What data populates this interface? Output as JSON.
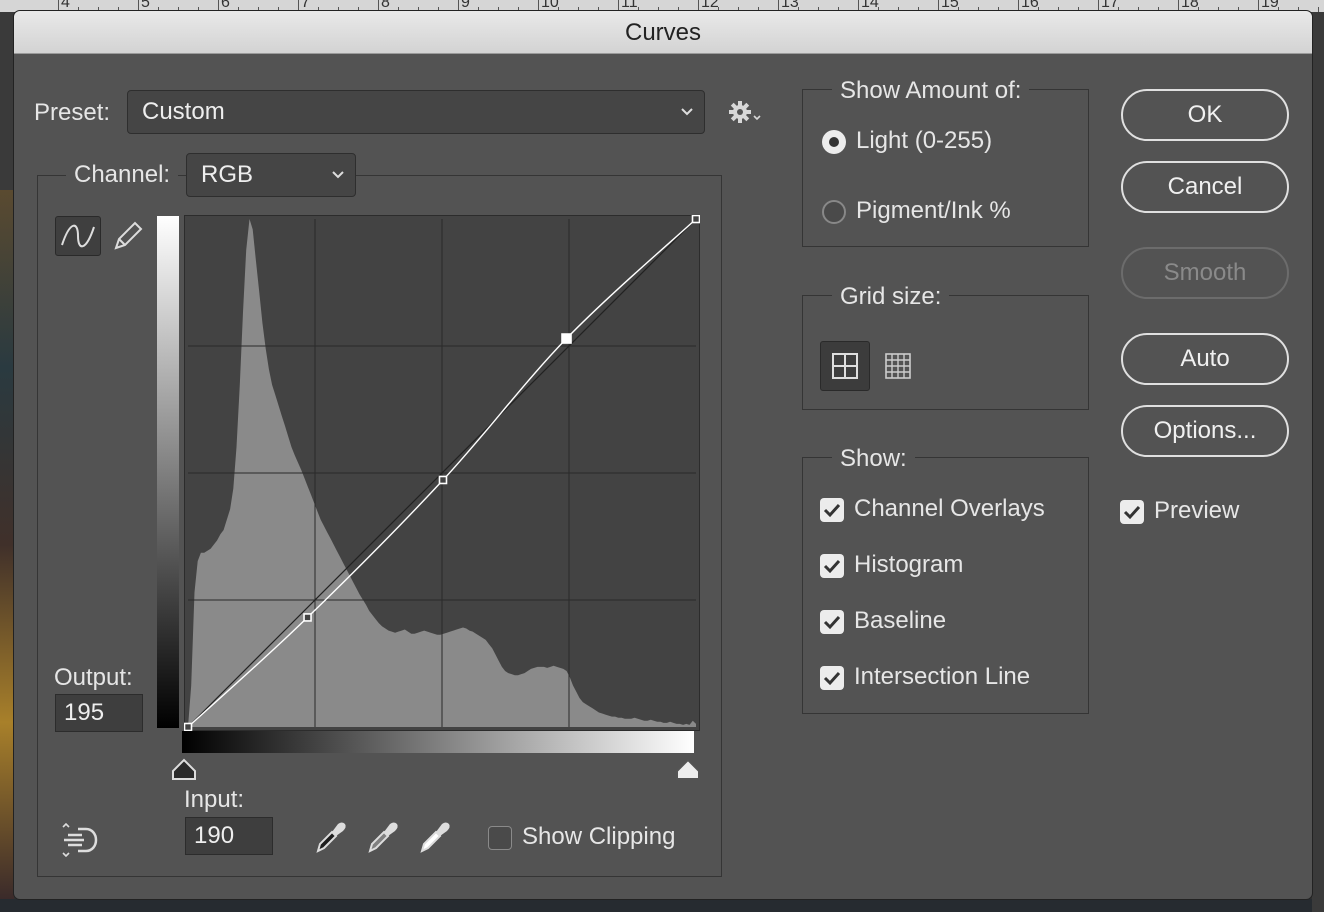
{
  "ruler": {
    "numbers": [
      "4",
      "5",
      "6",
      "7",
      "8",
      "9",
      "10",
      "11",
      "12",
      "13",
      "14",
      "15",
      "16",
      "17",
      "18",
      "19"
    ]
  },
  "dialog": {
    "title": "Curves",
    "preset": {
      "label": "Preset:",
      "value": "Custom"
    },
    "channel": {
      "label": "Channel:",
      "value": "RGB"
    },
    "output": {
      "label": "Output:",
      "value": "195"
    },
    "input": {
      "label": "Input:",
      "value": "190"
    },
    "show_clipping": {
      "label": "Show Clipping",
      "checked": false
    },
    "show_amount": {
      "title": "Show Amount of:",
      "options": [
        {
          "label": "Light  (0-255)",
          "selected": true
        },
        {
          "label": "Pigment/Ink %",
          "selected": false
        }
      ]
    },
    "grid_size": {
      "title": "Grid size:",
      "selected": "simple-grid"
    },
    "show": {
      "title": "Show:",
      "items": [
        {
          "label": "Channel Overlays",
          "checked": true
        },
        {
          "label": "Histogram",
          "checked": true
        },
        {
          "label": "Baseline",
          "checked": true
        },
        {
          "label": "Intersection Line",
          "checked": true
        }
      ]
    },
    "buttons": {
      "ok": "OK",
      "cancel": "Cancel",
      "smooth": "Smooth",
      "auto": "Auto",
      "options": "Options..."
    },
    "preview": {
      "label": "Preview",
      "checked": true
    },
    "icons": {
      "gear": "gear-icon",
      "curve_tool": "curve-tool-icon",
      "pencil": "pencil-icon",
      "target_adjust": "target-adjust-icon",
      "eyedroppers": [
        "black-point-eyedropper-icon",
        "gray-point-eyedropper-icon",
        "white-point-eyedropper-icon"
      ]
    },
    "colors": {
      "dialog_bg": "#535353",
      "graph_bg": "#434343",
      "histogram": "#8a8a8a",
      "curve": "#ffffff"
    }
  },
  "chart_data": {
    "type": "line",
    "x_range": [
      0,
      255
    ],
    "y_range": [
      0,
      255
    ],
    "grid_divisions": 4,
    "curve_points": [
      [
        0,
        0
      ],
      [
        60,
        55
      ],
      [
        128,
        124
      ],
      [
        190,
        195
      ],
      [
        255,
        255
      ]
    ],
    "selected_point": [
      190,
      195
    ],
    "histogram": [
      0,
      40,
      130,
      160,
      168,
      168,
      170,
      172,
      176,
      180,
      186,
      190,
      200,
      210,
      230,
      270,
      330,
      400,
      460,
      490,
      480,
      450,
      420,
      390,
      365,
      345,
      330,
      320,
      310,
      300,
      290,
      280,
      270,
      262,
      255,
      248,
      240,
      232,
      224,
      216,
      208,
      200,
      194,
      188,
      182,
      176,
      170,
      164,
      158,
      152,
      146,
      140,
      134,
      128,
      123,
      118,
      112,
      108,
      104,
      100,
      97,
      95,
      93,
      92,
      91,
      92,
      93,
      94,
      92,
      90,
      90,
      91,
      92,
      93,
      92,
      91,
      90,
      89,
      89,
      90,
      91,
      92,
      93,
      94,
      95,
      96,
      95,
      93,
      92,
      90,
      88,
      86,
      84,
      80,
      76,
      70,
      64,
      58,
      54,
      52,
      51,
      50,
      50,
      51,
      52,
      54,
      56,
      57,
      58,
      58,
      58,
      57,
      58,
      59,
      58,
      57,
      56,
      54,
      48,
      40,
      34,
      28,
      24,
      22,
      20,
      18,
      16,
      14,
      13,
      12,
      11,
      10,
      10,
      9,
      9,
      8,
      8,
      8,
      9,
      8,
      7,
      6,
      6,
      7,
      6,
      5,
      5,
      4,
      4,
      5,
      4,
      3,
      3,
      2,
      3,
      2,
      6,
      3
    ]
  }
}
